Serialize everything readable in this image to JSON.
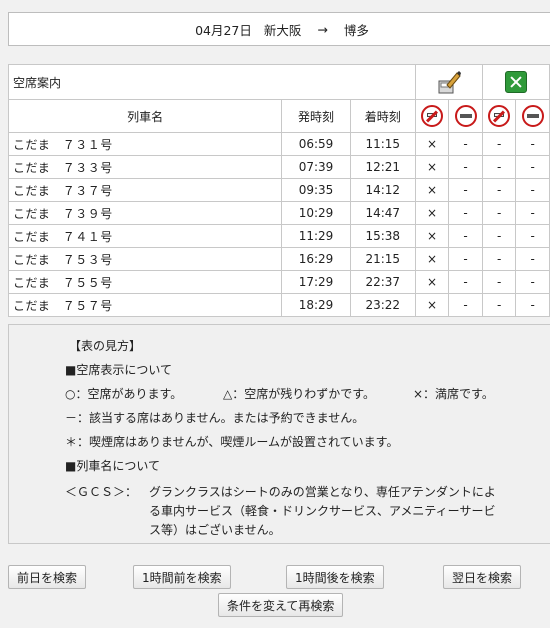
{
  "header": {
    "date": "04月27日",
    "from": "新大阪",
    "arrow": "→",
    "to": "博多"
  },
  "table": {
    "title": "空席案内",
    "col_train": "列車名",
    "col_depart": "発時刻",
    "col_arrive": "着時刻",
    "icons": [
      "green-car-pen-icon",
      "green-car-check-icon"
    ],
    "seat_types": [
      "no-smoking-icon",
      "no-entry-icon",
      "no-smoking-icon",
      "no-entry-icon"
    ],
    "rows": [
      {
        "name": "こだま　７３１号",
        "depart": "06:59",
        "arrive": "11:15",
        "s": [
          "×",
          "-",
          "-",
          "-"
        ]
      },
      {
        "name": "こだま　７３３号",
        "depart": "07:39",
        "arrive": "12:21",
        "s": [
          "×",
          "-",
          "-",
          "-"
        ]
      },
      {
        "name": "こだま　７３７号",
        "depart": "09:35",
        "arrive": "14:12",
        "s": [
          "×",
          "-",
          "-",
          "-"
        ]
      },
      {
        "name": "こだま　７３９号",
        "depart": "10:29",
        "arrive": "14:47",
        "s": [
          "×",
          "-",
          "-",
          "-"
        ]
      },
      {
        "name": "こだま　７４１号",
        "depart": "11:29",
        "arrive": "15:38",
        "s": [
          "×",
          "-",
          "-",
          "-"
        ]
      },
      {
        "name": "こだま　７５３号",
        "depart": "16:29",
        "arrive": "21:15",
        "s": [
          "×",
          "-",
          "-",
          "-"
        ]
      },
      {
        "name": "こだま　７５５号",
        "depart": "17:29",
        "arrive": "22:37",
        "s": [
          "×",
          "-",
          "-",
          "-"
        ]
      },
      {
        "name": "こだま　７５７号",
        "depart": "18:29",
        "arrive": "23:22",
        "s": [
          "×",
          "-",
          "-",
          "-"
        ]
      }
    ]
  },
  "legend": {
    "heading": "【表の見方】",
    "seat_section": "■空席表示について",
    "avail": "○：空席があります。",
    "few": "△：空席が残りわずかです。",
    "full": "×：満席です。",
    "none": "－：該当する席はありません。または予約できません。",
    "smoking": "＊：喫煙席はありませんが、喫煙ルームが設置されています。",
    "name_section": "■列車名について",
    "gcs_label": "＜ＧＣＳ＞：",
    "gcs_line1": "グランクラスはシートのみの営業となり、専任アテンダントによ",
    "gcs_line2": "る車内サービス（軽食・ドリンクサービス、アメニティーサービ",
    "gcs_line3": "ス等）はございません。"
  },
  "buttons": {
    "prev_day": "前日を検索",
    "prev_hour": "1時間前を検索",
    "next_hour": "1時間後を検索",
    "next_day": "翌日を検索",
    "change": "条件を変えて再検索"
  }
}
